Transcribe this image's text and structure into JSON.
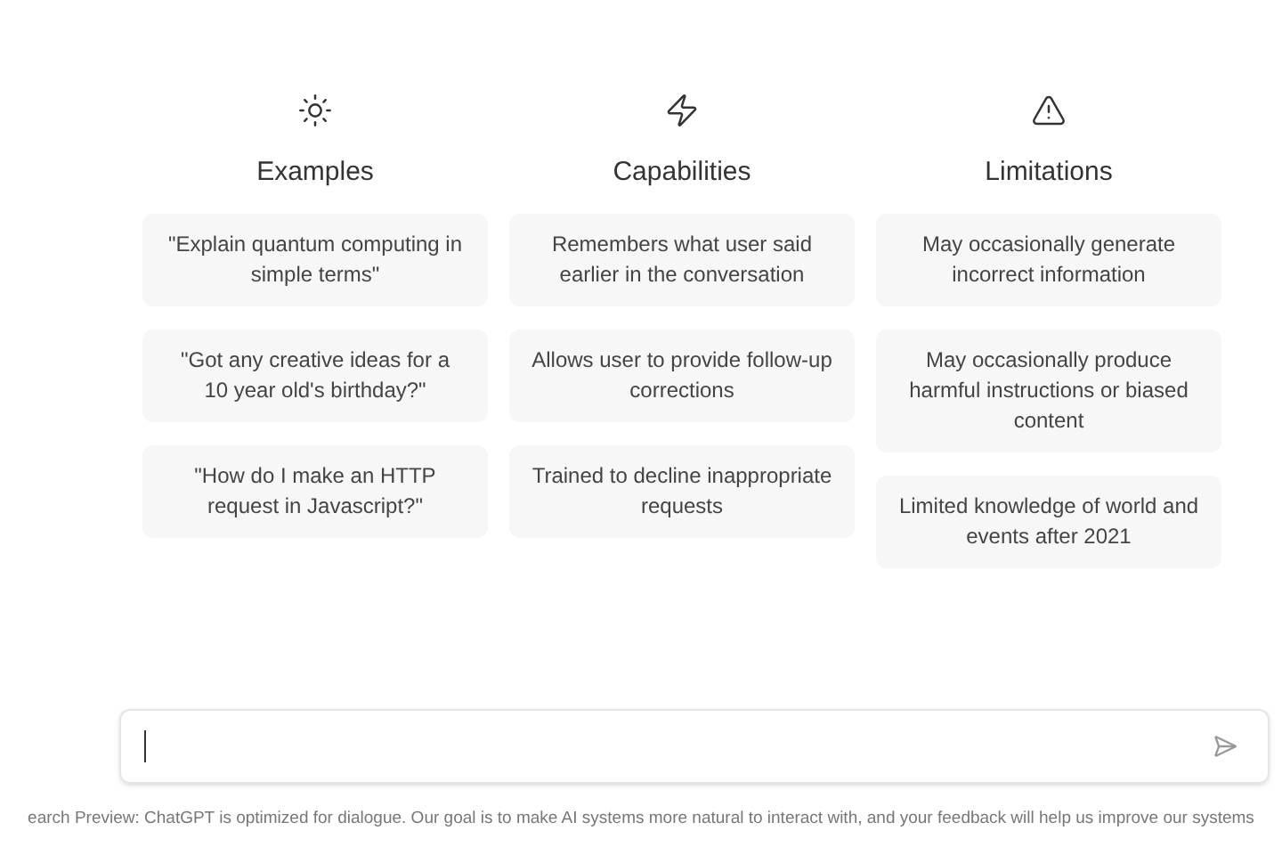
{
  "columns": [
    {
      "title": "Examples",
      "cards": [
        "\"Explain quantum computing in simple terms\"",
        "\"Got any creative ideas for a 10 year old's birthday?\"",
        "\"How do I make an HTTP request in Javascript?\""
      ]
    },
    {
      "title": "Capabilities",
      "cards": [
        "Remembers what user said earlier in the conversation",
        "Allows user to provide follow-up corrections",
        "Trained to decline inappropriate requests"
      ]
    },
    {
      "title": "Limitations",
      "cards": [
        "May occasionally generate incorrect information",
        "May occasionally produce harmful instructions or biased content",
        "Limited knowledge of world and events after 2021"
      ]
    }
  ],
  "footer": "earch Preview: ChatGPT is optimized for dialogue. Our goal is to make AI systems more natural to interact with, and your feedback will help us improve our systems"
}
